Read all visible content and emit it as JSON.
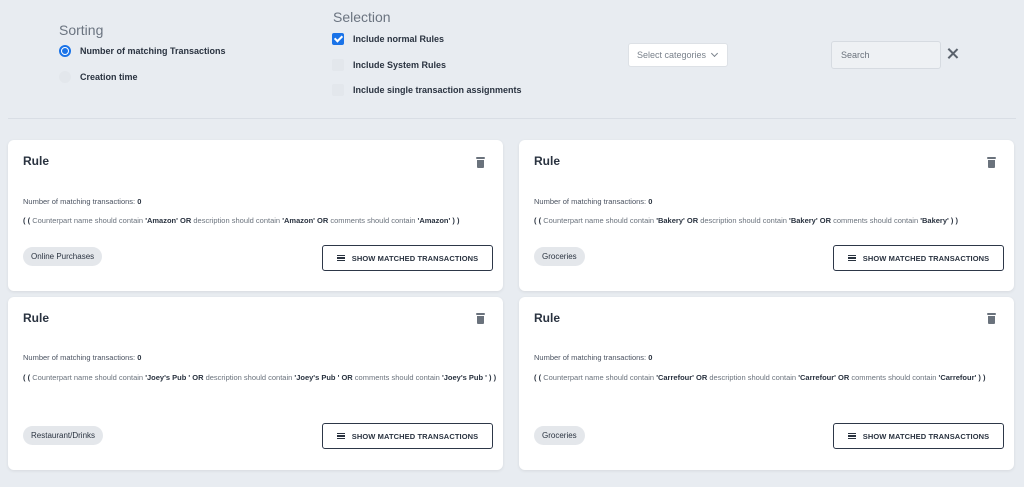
{
  "sorting": {
    "title": "Sorting",
    "options": [
      {
        "label": "Number of matching Transactions",
        "selected": true
      },
      {
        "label": "Creation time",
        "selected": false
      }
    ]
  },
  "selection": {
    "title": "Selection",
    "options": [
      {
        "label": "Include normal Rules",
        "checked": true
      },
      {
        "label": "Include System Rules",
        "checked": false
      },
      {
        "label": "Include single transaction assignments",
        "checked": false
      }
    ]
  },
  "category_select": {
    "placeholder": "Select categories"
  },
  "search": {
    "placeholder": "Search"
  },
  "common": {
    "count_label": "Number of matching transactions:",
    "show_button_label": "SHOW MATCHED TRANSACTIONS",
    "kw_open": "( (",
    "kw_close": ") )",
    "kw_or": "OR",
    "p_counterpart": "Counterpart name should contain",
    "p_description": "description should contain",
    "p_comments": "comments should contain"
  },
  "rules": [
    {
      "title": "Rule",
      "count": "0",
      "term": "'Amazon'",
      "category": "Online Purchases"
    },
    {
      "title": "Rule",
      "count": "0",
      "term": "'Bakery'",
      "category": "Groceries"
    },
    {
      "title": "Rule",
      "count": "0",
      "term": "'Joey's Pub '",
      "category": "Restaurant/Drinks"
    },
    {
      "title": "Rule",
      "count": "0",
      "term": "'Carrefour'",
      "category": "Groceries"
    }
  ],
  "colors": {
    "accent": "#1a73e8",
    "background": "#e8ecf1",
    "card": "#ffffff",
    "text": "#2a3340"
  }
}
